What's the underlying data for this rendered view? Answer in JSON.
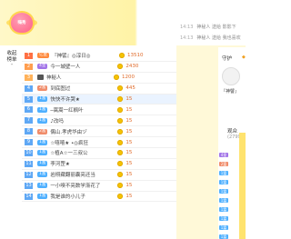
{
  "banner": {
    "logo_text": "嗨秀"
  },
  "chat": [
    {
      "time": "14:13",
      "text": "神秘人 送给 影影下"
    },
    {
      "time": "14:13",
      "text": "神秘人 送给 我也喜欢"
    }
  ],
  "tabs": [
    "收起",
    "榜单"
  ],
  "rows": [
    {
      "rank": "1",
      "rank_color": "#ff7043",
      "badge": "亿金",
      "badge_color": "#ff8a3d",
      "name": "『神譬』◎淳日◎",
      "value": "13510",
      "sel": false
    },
    {
      "rank": "2",
      "rank_color": "#ff9e4f",
      "badge": "4皇",
      "badge_color": "#a274e8",
      "name": "今一城壁一人",
      "value": "2430",
      "sel": false
    },
    {
      "rank": "3",
      "rank_color": "#ffb25a",
      "badge": "",
      "badge_color": "",
      "name": "神秘人",
      "value": "1200",
      "sel": false,
      "plain": true
    },
    {
      "rank": "4",
      "rank_color": "#5fa8f5",
      "badge": "2富",
      "badge_color": "#f08c6a",
      "name": "到底图过",
      "value": "445",
      "sel": false
    },
    {
      "rank": "5",
      "rank_color": "#5fa8f5",
      "badge": "1富",
      "badge_color": "#4fb0ff",
      "name": "快快不许哭★",
      "value": "15",
      "sel": true
    },
    {
      "rank": "6",
      "rank_color": "#5fa8f5",
      "badge": "1富",
      "badge_color": "#4fb0ff",
      "name": "─嵩嵩一红枫叶",
      "value": "15",
      "sel": false
    },
    {
      "rank": "7",
      "rank_color": "#5fa8f5",
      "badge": "1富",
      "badge_color": "#4fb0ff",
      "name": "♪改吗",
      "value": "15",
      "sel": false
    },
    {
      "rank": "8",
      "rank_color": "#5fa8f5",
      "badge": "2富",
      "badge_color": "#f08c6a",
      "name": "偶山.孝虎华由ヅ",
      "value": "15",
      "sel": false
    },
    {
      "rank": "9",
      "rank_color": "#5fa8f5",
      "badge": "1富",
      "badge_color": "#4fb0ff",
      "name": "☆嘻嘻★ •◎疯狂",
      "value": "15",
      "sel": false
    },
    {
      "rank": "10",
      "rank_color": "#5fa8f5",
      "badge": "1富",
      "badge_color": "#4fb0ff",
      "name": "☆植A☆一三叔公",
      "value": "15",
      "sel": false
    },
    {
      "rank": "11",
      "rank_color": "#5fa8f5",
      "badge": "1富",
      "badge_color": "#4fb0ff",
      "name": "李河罡★",
      "value": "15",
      "sel": false
    },
    {
      "rank": "12",
      "rank_color": "#5fa8f5",
      "badge": "1富",
      "badge_color": "#4fb0ff",
      "name": "岩栩藏翻丽囊亮还当",
      "value": "15",
      "sel": false
    },
    {
      "rank": "13",
      "rank_color": "#5fa8f5",
      "badge": "1富",
      "badge_color": "#4fb0ff",
      "name": "一小嗅不亮数学渐花了",
      "value": "15",
      "sel": false
    },
    {
      "rank": "14",
      "rank_color": "#5fa8f5",
      "badge": "1富",
      "badge_color": "#4fb0ff",
      "name": "我是谁的小儿子",
      "value": "15",
      "sel": false
    }
  ],
  "guard": {
    "title": "守护",
    "name": "『神譬』"
  },
  "audience": {
    "title": "观众",
    "count": "(2799)"
  },
  "viewer_badges": [
    {
      "label": "4皇",
      "color": "#a274e8"
    },
    {
      "label": "2富",
      "color": "#f08c6a"
    },
    {
      "label": "1富",
      "color": "#4fb0ff"
    },
    {
      "label": "1富",
      "color": "#4fb0ff"
    },
    {
      "label": "1富",
      "color": "#4fb0ff"
    },
    {
      "label": "1富",
      "color": "#4fb0ff"
    },
    {
      "label": "1富",
      "color": "#4fb0ff"
    },
    {
      "label": "1富",
      "color": "#4fb0ff"
    },
    {
      "label": "1富",
      "color": "#4fb0ff"
    },
    {
      "label": "1富",
      "color": "#4fb0ff"
    }
  ]
}
